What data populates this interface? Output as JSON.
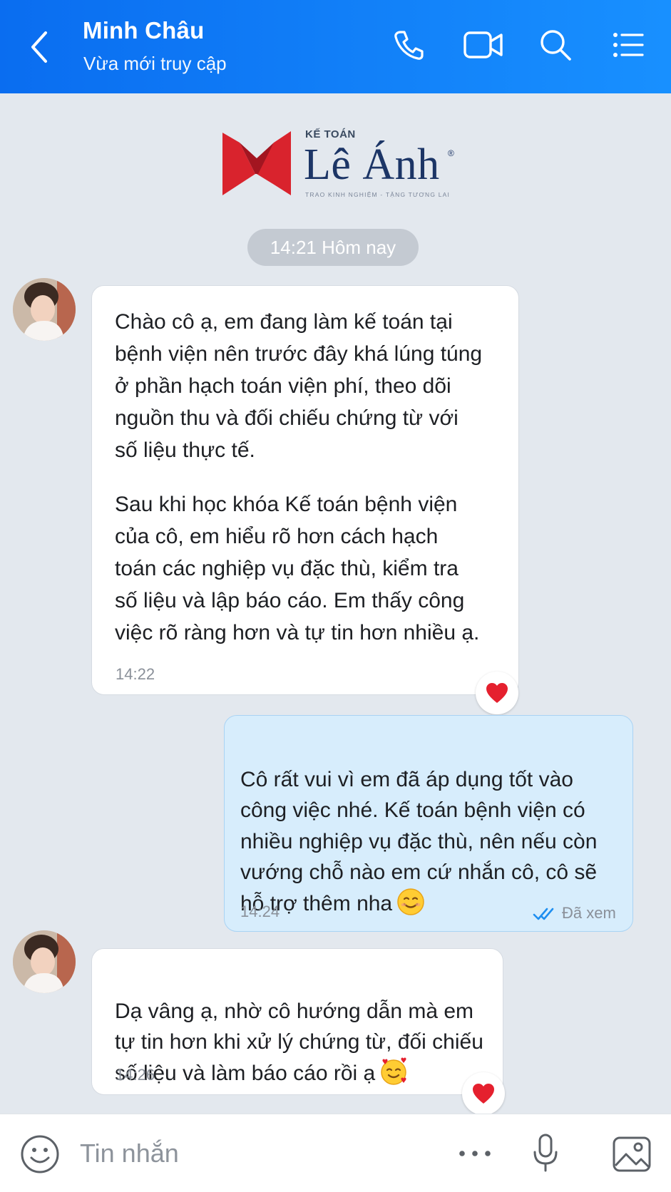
{
  "header": {
    "contact_name": "Minh Châu",
    "status": "Vừa mới truy cập",
    "icons": [
      "back-icon",
      "phone-icon",
      "video-call-icon",
      "search-icon",
      "menu-list-icon"
    ]
  },
  "logo": {
    "brand_small": "KẾ TOÁN",
    "brand_name": "Lê Ánh",
    "registered": "®",
    "slogan": "TRAO KINH NGHIỆM - TẶNG TƯƠNG LAI"
  },
  "conversation": {
    "date_separator": "14:21 Hôm nay",
    "messages": [
      {
        "direction": "incoming",
        "paragraph_1": "Chào cô ạ, em đang làm kế toán tại\nbệnh viện nên trước đây khá lúng túng\nở phần hạch toán viện phí, theo dõi\nnguồn thu và đối chiếu chứng từ với\nsố liệu thực tế.",
        "paragraph_2": "Sau khi học khóa Kế toán bệnh viện\ncủa cô, em hiểu rõ hơn cách hạch\ntoán các nghiệp vụ đặc thù, kiểm tra\nsố liệu và lập báo cáo. Em thấy công\nviệc rõ ràng hơn và tự tin hơn nhiều ạ.",
        "time": "14:22",
        "reaction": "heart"
      },
      {
        "direction": "outgoing",
        "text": "Cô rất vui vì em đã áp dụng tốt vào\ncông việc nhé. Kế toán bệnh viện có\nnhiều nghiệp vụ đặc thù, nên nếu còn\nvướng chỗ nào em cứ nhắn cô, cô sẽ\nhỗ trợ thêm nha",
        "emoji": "smiling-face",
        "time": "14:24",
        "seen_label": "Đã xem"
      },
      {
        "direction": "incoming",
        "text": "Dạ vâng ạ, nhờ cô hướng dẫn mà em\ntự tin hơn khi xử lý chứng từ, đối chiếu\nsố liệu và làm báo cáo rồi ạ",
        "emoji": "smiling-face-with-hearts",
        "time": "14:26",
        "reaction": "heart"
      }
    ]
  },
  "composer": {
    "placeholder": "Tin nhắn",
    "icons": [
      "emoji-icon",
      "more-icon",
      "microphone-icon",
      "image-icon"
    ]
  },
  "colors": {
    "header_blue": "#0a6df0",
    "chat_background": "#e3e8ee",
    "outgoing_bubble": "#d7edfc",
    "incoming_bubble": "#ffffff",
    "heart": "#e5202e",
    "seen_check": "#1e8ef0",
    "logo_red": "#d9232d",
    "logo_navy": "#1c3566"
  }
}
